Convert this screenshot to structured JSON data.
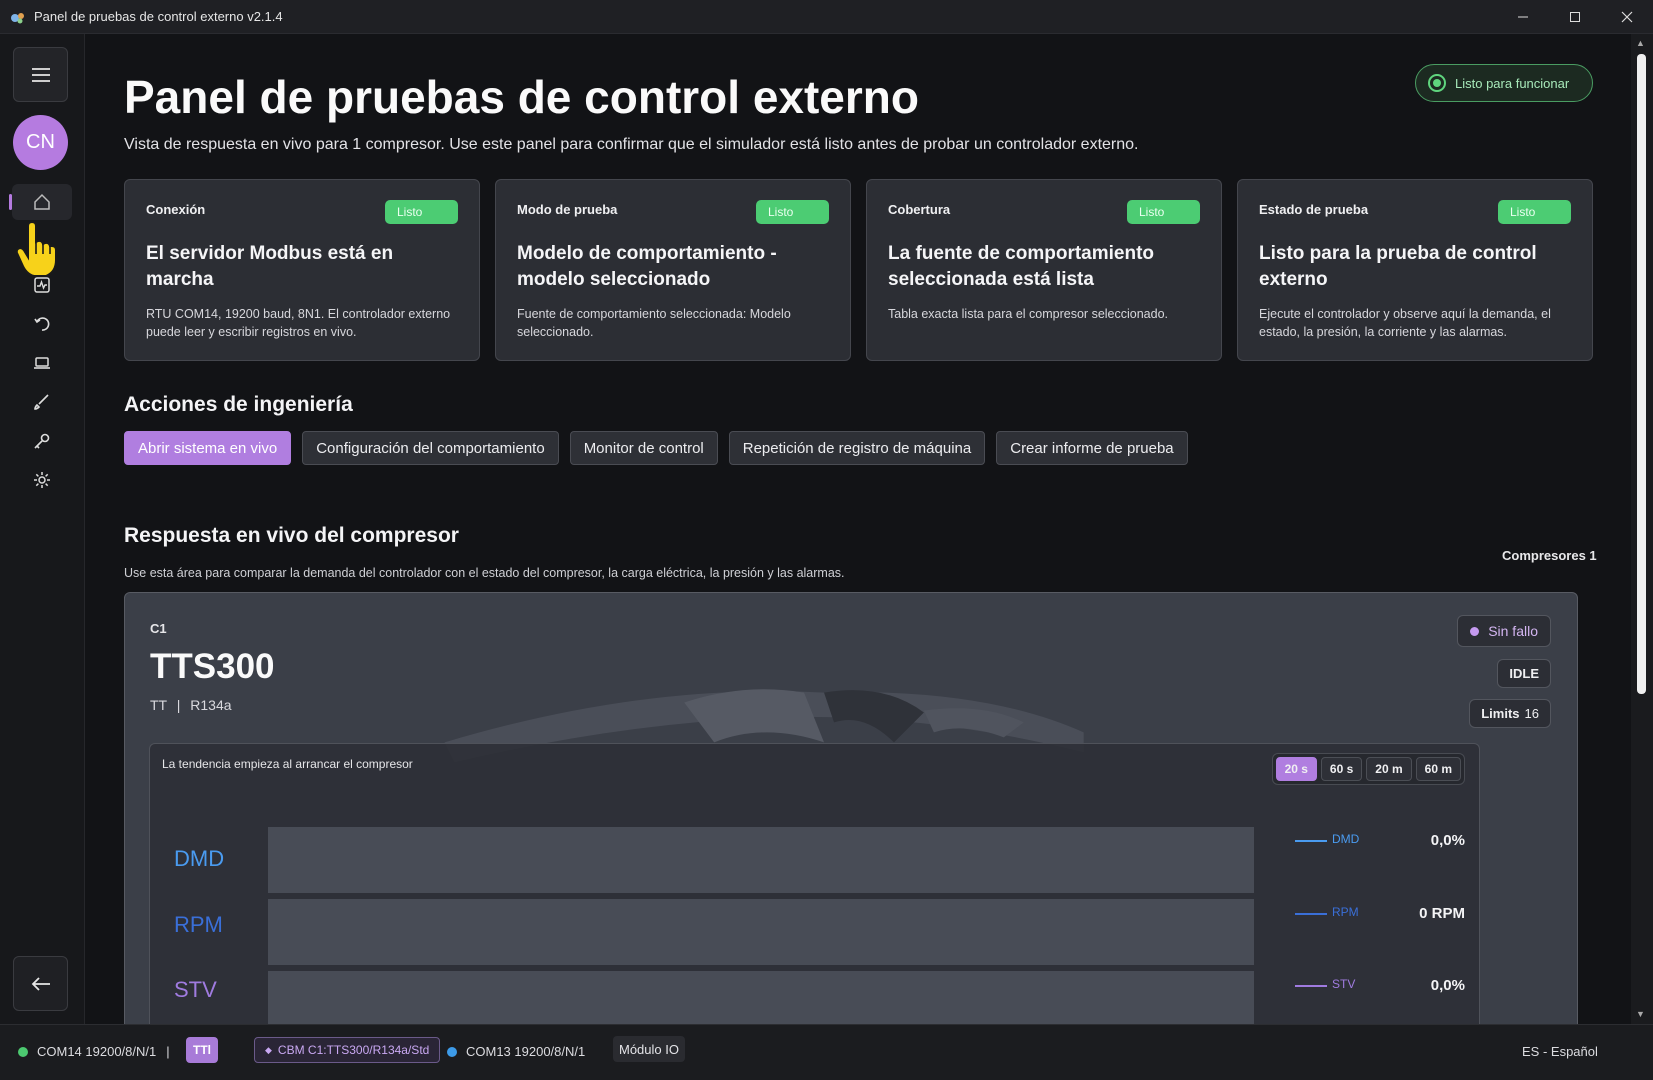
{
  "window": {
    "title": "Panel de pruebas de control externo v2.1.4"
  },
  "sidebar": {
    "avatar_initials": "CN"
  },
  "header": {
    "title": "Panel de pruebas de control externo",
    "subtitle": "Vista de respuesta en vivo para 1 compresor. Use este panel para confirmar que el simulador está listo antes de probar un controlador externo.",
    "ready_status": "Listo para funcionar"
  },
  "cards": [
    {
      "kicker": "Conexión",
      "badge": "Listo",
      "heading": "El servidor Modbus está en marcha",
      "detail": "RTU COM14, 19200 baud, 8N1. El controlador externo puede leer y escribir registros en vivo."
    },
    {
      "kicker": "Modo de prueba",
      "badge": "Listo",
      "heading": "Modelo de comportamiento - modelo seleccionado",
      "detail": "Fuente de comportamiento seleccionada: Modelo seleccionado."
    },
    {
      "kicker": "Cobertura",
      "badge": "Listo",
      "heading": "La fuente de comportamiento seleccionada está lista",
      "detail": "Tabla exacta lista para el compresor seleccionado."
    },
    {
      "kicker": "Estado de prueba",
      "badge": "Listo",
      "heading": "Listo para la prueba de control externo",
      "detail": "Ejecute el controlador y observe aquí la demanda, el estado, la presión, la corriente y las alarmas."
    }
  ],
  "engineering": {
    "title": "Acciones de ingeniería",
    "actions": [
      "Abrir sistema en vivo",
      "Configuración del comportamiento",
      "Monitor de control",
      "Repetición de registro de máquina",
      "Crear informe de prueba"
    ]
  },
  "response": {
    "title": "Respuesta en vivo del compresor",
    "subtitle": "Use esta área para comparar la demanda del controlador con el estado del compresor, la carga eléctrica, la presión y las alarmas.",
    "count_label": "Compresores 1"
  },
  "compressor": {
    "id": "C1",
    "model": "TTS300",
    "type": "TT",
    "refrigerant": "R134a",
    "fault_status": "Sin fallo",
    "state": "IDLE",
    "limits_label": "Limits",
    "limits_value": "16"
  },
  "trend": {
    "caption": "La tendencia empieza al arrancar el compresor",
    "ranges": [
      "20 s",
      "60 s",
      "20 m",
      "60 m"
    ],
    "active_range": "20 s",
    "metrics": [
      {
        "label": "DMD",
        "legend": "DMD",
        "value": "0,0%",
        "color": "#4a9bf0"
      },
      {
        "label": "RPM",
        "legend": "RPM",
        "value": "0 RPM",
        "color": "#3a6fd8"
      },
      {
        "label": "STV",
        "legend": "STV",
        "value": "0,0%",
        "color": "#a07be0"
      }
    ]
  },
  "statusbar": {
    "port1": "COM14 19200/8/N/1",
    "separator": "|",
    "ttl_tag": "TTl",
    "cbm_tag": "CBM C1:TTS300/R134a/Std",
    "port2": "COM13 19200/8/N/1",
    "io_module": "Módulo IO",
    "language": "ES - Español",
    "colors": {
      "ok": "#4cc970",
      "info": "#3d9be9"
    }
  }
}
